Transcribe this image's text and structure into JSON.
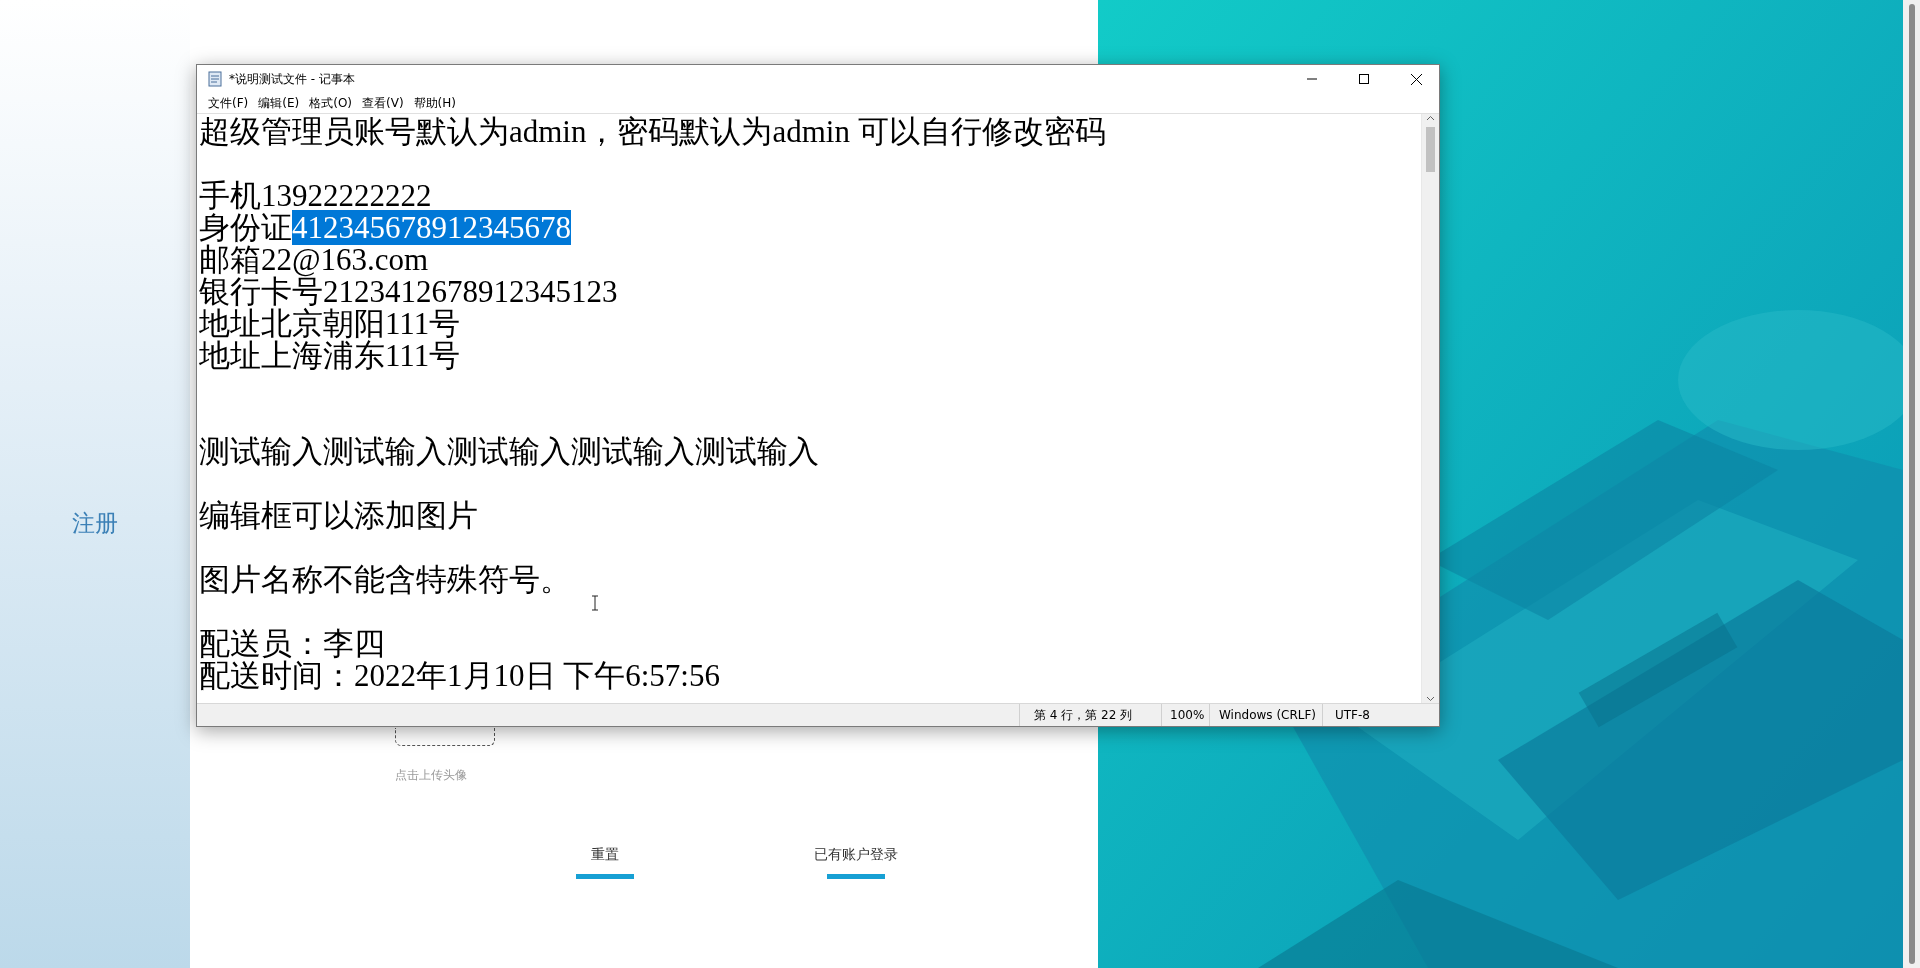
{
  "page": {
    "sidebar": {
      "register_link": "注册"
    },
    "avatar_upload": {
      "hint": "点击上传头像"
    },
    "buttons": [
      "重置",
      "已有账户登录"
    ]
  },
  "notepad": {
    "title": "*说明测试文件 - 记事本",
    "menu": [
      "文件(F)",
      "编辑(E)",
      "格式(O)",
      "查看(V)",
      "帮助(H)"
    ],
    "lines": [
      {
        "kind": "text",
        "segments": [
          {
            "text": "超级管理员账号默认为admin，密码默认为admin 可以自行修改密码",
            "selected": false
          }
        ]
      },
      {
        "kind": "blank"
      },
      {
        "kind": "text",
        "segments": [
          {
            "text": "手机13922222222",
            "selected": false
          }
        ]
      },
      {
        "kind": "text",
        "segments": [
          {
            "text": "身份证",
            "selected": false
          },
          {
            "text": "412345678912345678",
            "selected": true
          }
        ]
      },
      {
        "kind": "text",
        "segments": [
          {
            "text": "邮箱22@163.com",
            "selected": false
          }
        ]
      },
      {
        "kind": "text",
        "segments": [
          {
            "text": "银行卡号2123412678912345123",
            "selected": false
          }
        ]
      },
      {
        "kind": "text",
        "segments": [
          {
            "text": "地址北京朝阳111号",
            "selected": false
          }
        ]
      },
      {
        "kind": "text",
        "segments": [
          {
            "text": "地址上海浦东111号",
            "selected": false
          }
        ]
      },
      {
        "kind": "blank"
      },
      {
        "kind": "blank"
      },
      {
        "kind": "text",
        "segments": [
          {
            "text": "测试输入测试输入测试输入测试输入测试输入",
            "selected": false
          }
        ]
      },
      {
        "kind": "blank"
      },
      {
        "kind": "text",
        "segments": [
          {
            "text": "编辑框可以添加图片",
            "selected": false
          }
        ]
      },
      {
        "kind": "blank"
      },
      {
        "kind": "text",
        "segments": [
          {
            "text": "图片名称不能含特殊符号。",
            "selected": false
          }
        ]
      },
      {
        "kind": "blank"
      },
      {
        "kind": "text",
        "segments": [
          {
            "text": "配送员：李四",
            "selected": false
          }
        ]
      },
      {
        "kind": "text",
        "segments": [
          {
            "text": "配送时间：2022年1月10日 下午6:57:56",
            "selected": false
          }
        ]
      }
    ],
    "status_bar": {
      "position": "第 4 行，第 22 列",
      "zoom": "100%",
      "line_ending": "Windows (CRLF)",
      "encoding": "UTF-8"
    }
  }
}
